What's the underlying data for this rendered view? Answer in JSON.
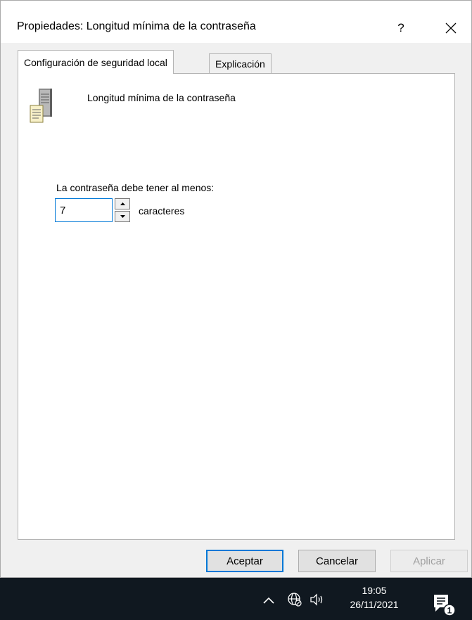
{
  "dialog": {
    "title": "Propiedades: Longitud mínima de la contraseña",
    "help_label": "?"
  },
  "tabs": [
    {
      "label": "Configuración de seguridad local",
      "active": true
    },
    {
      "label": "Explicación",
      "active": false
    }
  ],
  "panel": {
    "policy_name": "Longitud mínima de la contraseña",
    "prompt": "La contraseña debe tener al menos:",
    "length_value": "7",
    "unit_label": "caracteres"
  },
  "buttons": {
    "ok": "Aceptar",
    "cancel": "Cancelar",
    "apply": "Aplicar"
  },
  "taskbar": {
    "time": "19:05",
    "date": "26/11/2021",
    "notification_count": "1"
  },
  "icons": {
    "policy": "server-policy-icon",
    "close": "close-icon",
    "chevron": "chevron-up-icon",
    "network": "network-icon",
    "volume": "volume-icon",
    "notifications": "notification-icon"
  },
  "colors": {
    "focus_accent": "#0078d7",
    "taskbar": "#101820"
  }
}
